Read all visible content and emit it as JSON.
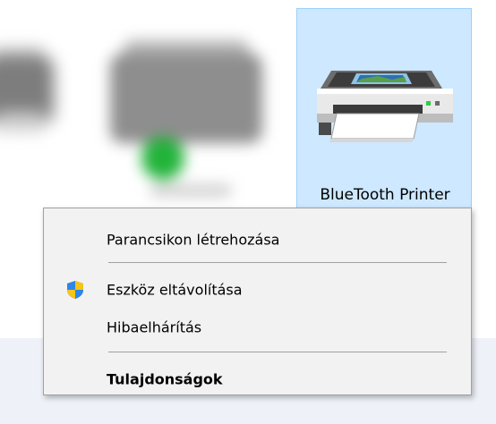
{
  "device": {
    "name": "BlueTooth Printer",
    "icon": "printer-icon"
  },
  "context_menu": {
    "items": [
      {
        "label": "Parancsikon létrehozása",
        "icon": null,
        "bold": false
      },
      {
        "label": "Eszköz eltávolítása",
        "icon": "uac-shield-icon",
        "bold": false
      },
      {
        "label": "Hibaelhárítás",
        "icon": null,
        "bold": false
      },
      {
        "label": "Tulajdonságok",
        "icon": null,
        "bold": true
      }
    ]
  },
  "colors": {
    "selection_fill": "#cde8ff",
    "selection_border": "#99d1ff",
    "menu_background": "#f2f2f2",
    "menu_border": "#a0a0a0",
    "status_green": "#22b33a"
  }
}
